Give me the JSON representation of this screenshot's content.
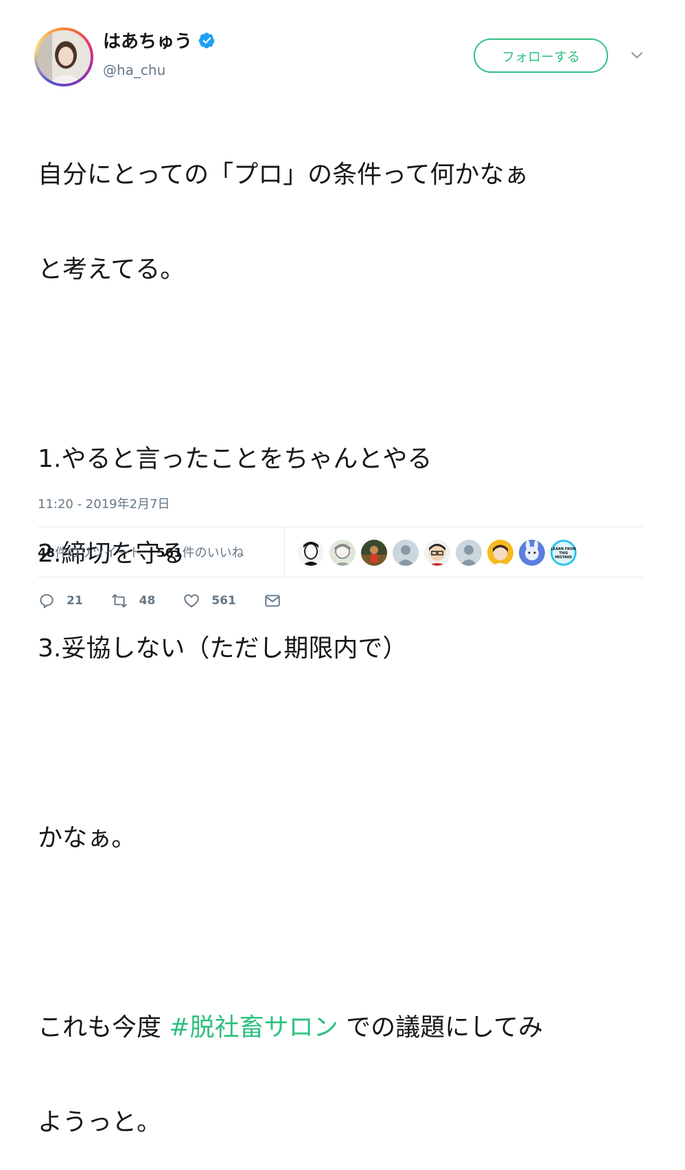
{
  "user": {
    "display_name": "はあちゅう",
    "handle": "@ha_chu",
    "verified_icon": "verified-badge-icon",
    "accent_color": "#1da1f2"
  },
  "follow_button": {
    "label": "フォローする",
    "color": "#2ec07f"
  },
  "tweet": {
    "line1": "自分にとっての「プロ」の条件って何かなぁ",
    "line2": "と考えてる。",
    "item1": "1.やると言ったことをちゃんとやる",
    "item2": "2.締切を守る",
    "item3": "3.妥協しない（ただし期限内で）",
    "line3": "かなぁ。",
    "line4_prefix": "これも今度 ",
    "hashtag": "#脱社畜サロン",
    "line4_suffix": " での議題にしてみ",
    "line5": "ようっと。"
  },
  "timestamp": "11:20 - 2019年2月7日",
  "stats": {
    "retweets_count": "48",
    "retweets_label": "件のリツイート",
    "likes_count": "561",
    "likes_label": "件のいいね"
  },
  "likers": [
    {
      "icon": "liker-avatar-1"
    },
    {
      "icon": "liker-avatar-2"
    },
    {
      "icon": "liker-avatar-3"
    },
    {
      "icon": "default-avatar-icon"
    },
    {
      "icon": "liker-avatar-5"
    },
    {
      "icon": "default-avatar-icon"
    },
    {
      "icon": "liker-avatar-7"
    },
    {
      "icon": "liker-avatar-8"
    },
    {
      "icon": "liker-avatar-9",
      "text": "LEARN FROM THIS MISTAKE"
    }
  ],
  "actions": {
    "reply_count": "21",
    "retweet_count": "48",
    "like_count": "561"
  }
}
